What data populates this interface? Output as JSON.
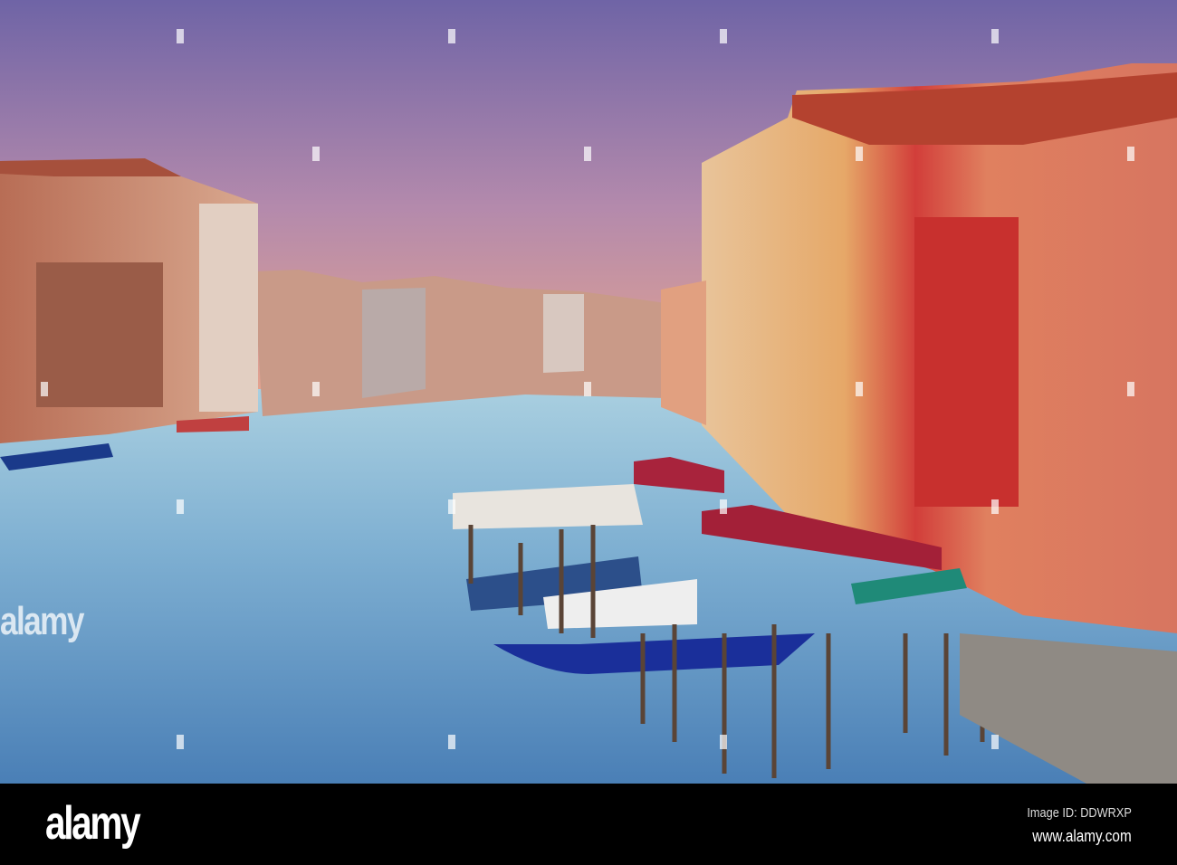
{
  "watermark": {
    "text": "alamy"
  },
  "footer": {
    "logo": "alamy",
    "image_id": "Image ID: DDWRXP",
    "url": "www.alamy.com"
  },
  "colors": {
    "sky_top": "#6f64a6",
    "sky_horizon": "#eaa78c",
    "water_far": "#9cc6dc",
    "water_near": "#3f78b0"
  }
}
